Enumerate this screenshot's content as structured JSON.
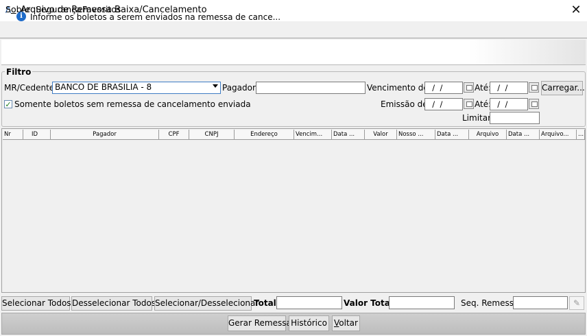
{
  "window": {
    "title": "Arquivo de Remessa Baixa/Cancelamento",
    "close_glyph": "✕"
  },
  "menu": {
    "items": [
      {
        "label_pre": "S",
        "label_ul": "o",
        "label_post": "bre"
      },
      {
        "label": "Segurança"
      },
      {
        "label": "Favoritos"
      }
    ]
  },
  "info": {
    "icon": "info-icon",
    "text": "Informe os boletos a serem enviados na remessa de cance..."
  },
  "filter": {
    "legend": "Filtro",
    "cedente_label": "MR/Cedente:",
    "cedente_value": "BANCO DE BRASILIA - 8",
    "pagador_label": "Pagador:",
    "pagador_value": "",
    "vencimento_label": "Vencimento de:",
    "vencimento_from": "  /  /",
    "ate_label": "Até:",
    "vencimento_to": "  /  /",
    "carregar_label": "Carregar...",
    "checkbox_label": "Somente boletos sem remessa de cancelamento enviada",
    "checkbox_checked": true,
    "emissao_label": "Emissão de:",
    "emissao_from": "  /  /",
    "emissao_ate_label": "Até:",
    "emissao_to": "  /  /",
    "limitar_label": "Limitar:",
    "limitar_value": ""
  },
  "table": {
    "columns": [
      "Nr",
      "ID",
      "Pagador",
      "CPF",
      "CNPJ",
      "Endereço",
      "Vencim...",
      "Data ...",
      "Valor",
      "Nosso ...",
      "Data ...",
      "Arquivo",
      "Data ...",
      "Arquivo...",
      "..."
    ]
  },
  "bottom": {
    "select_all": "Selecionar Todos",
    "deselect_all": "Desselecionar Todos",
    "toggle_select": "Selecionar/Desselecionar",
    "total_label": "Total:",
    "total_value": "",
    "valor_total_label": "Valor Total:",
    "valor_total_value": "",
    "seq_label": "Seq. Remessa:",
    "seq_value": ""
  },
  "actions": {
    "gerar": "Gerar Remessa",
    "historico": "Histórico",
    "voltar_ul": "V",
    "voltar_rest": "oltar"
  }
}
